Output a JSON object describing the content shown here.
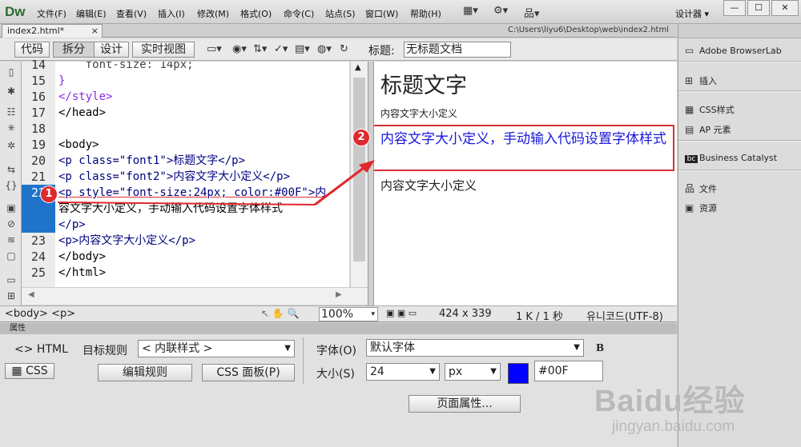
{
  "app": {
    "logo": "Dw"
  },
  "menu": [
    "文件(F)",
    "编辑(E)",
    "查看(V)",
    "插入(I)",
    "修改(M)",
    "格式(O)",
    "命令(C)",
    "站点(S)",
    "窗口(W)",
    "帮助(H)"
  ],
  "workspace": "设计器",
  "window_buttons": [
    "—",
    "☐",
    "✕"
  ],
  "tab": {
    "name": "index2.html*",
    "close": "×",
    "path": "C:\\Users\\liyu6\\Desktop\\web\\index2.html"
  },
  "doc_toolbar": {
    "views": [
      "代码",
      "拆分",
      "设计",
      "实时视图"
    ],
    "title_label": "标题:",
    "title_value": "无标题文档"
  },
  "code": {
    "line_numbers": [
      "14",
      "15",
      "16",
      "17",
      "18",
      "19",
      "20",
      "21",
      "22",
      "",
      "",
      "23",
      "24",
      "25"
    ],
    "lines": [
      "    font-size: 14px;",
      "}",
      "</style>",
      "</head>",
      "",
      "<body>",
      "<p class=\"font1\">标题文字</p>",
      "<p class=\"font2\">内容文字大小定义</p>",
      "<p style=\"font-size:24px; color:#00F\">内",
      "容文字大小定义，手动输入代码设置字体样式",
      "</p>",
      "<p>内容文字大小定义</p>",
      "</body>",
      "</html>"
    ]
  },
  "design_view": {
    "h1": "标题文字",
    "p1": "内容文字大小定义",
    "p2": "内容文字大小定义，手动输入代码设置字体样式",
    "p3": "内容文字大小定义"
  },
  "callouts": [
    "1",
    "2"
  ],
  "status": {
    "tag_path": "<body> <p>",
    "zoom": "100%",
    "dims": "424 x 339",
    "size_time": "1 K / 1 秒",
    "encoding": "유니코드(UTF-8)"
  },
  "properties": {
    "bar_title": "属性",
    "html_btn": "HTML",
    "css_btn": "CSS",
    "target_rule_label": "目标规则",
    "target_rule_value": "< 内联样式 >",
    "edit_rule": "编辑规则",
    "css_panel": "CSS 面板(P)",
    "font_label": "字体(O)",
    "font_value": "默认字体",
    "bold": "B",
    "size_label": "大小(S)",
    "size_value": "24",
    "unit_value": "px",
    "color_value": "#00F",
    "swatch_color": "#0000ff",
    "page_props": "页面属性..."
  },
  "right_panel": [
    "Adobe BrowserLab",
    "插入",
    "CSS样式",
    "AP 元素",
    "Business Catalyst",
    "文件",
    "资源"
  ],
  "watermark": {
    "brand": "Baidu经验",
    "url": "jingyan.baidu.com"
  }
}
